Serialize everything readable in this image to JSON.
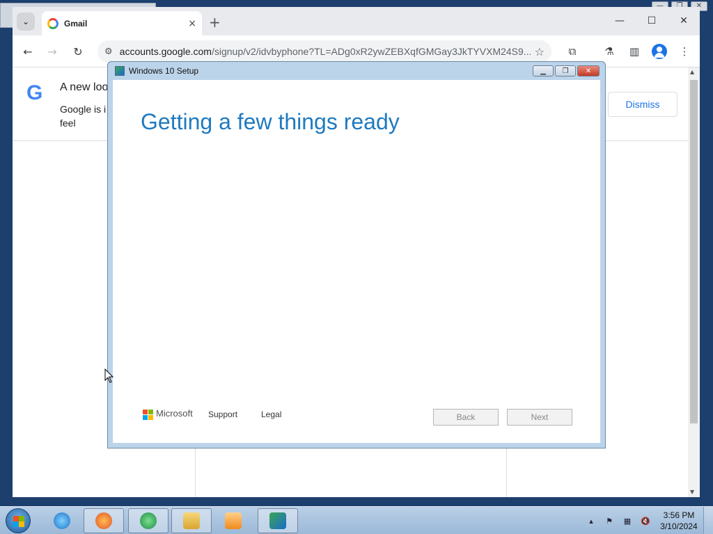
{
  "background_window": {
    "controls": [
      "—",
      "❐",
      "✕"
    ]
  },
  "browser": {
    "tab_title": "Gmail",
    "tab_close": "×",
    "new_tab": "+",
    "window_controls": [
      "—",
      "☐",
      "✕"
    ],
    "url_host": "accounts.google.com",
    "url_rest": "/signup/v2/idvbyphone?TL=ADg0xR2ywZEBXqfGMGay3JkTYVXM24S9..."
  },
  "banner": {
    "logo": "G",
    "title": "A new loo",
    "text": "Google is i feel",
    "dismiss_label": "Dismiss"
  },
  "setup_dialog": {
    "title": "Windows 10 Setup",
    "heading": "Getting a few things ready",
    "brand": "Microsoft",
    "support_label": "Support",
    "legal_label": "Legal",
    "back_label": "Back",
    "next_label": "Next",
    "controls": [
      "▁",
      "❐",
      "✕"
    ]
  },
  "taskbar": {
    "time": "3:56 PM",
    "date": "3/10/2024",
    "apps": [
      "internet-explorer",
      "firefox",
      "media-center",
      "file-explorer",
      "media-player",
      "windows-setup"
    ]
  },
  "colors": {
    "heading_blue": "#1f7ac0",
    "dismiss_blue": "#1a73e8",
    "ms_red": "#f25022",
    "ms_green": "#7fba00",
    "ms_blue": "#00a4ef",
    "ms_yellow": "#ffb900"
  }
}
